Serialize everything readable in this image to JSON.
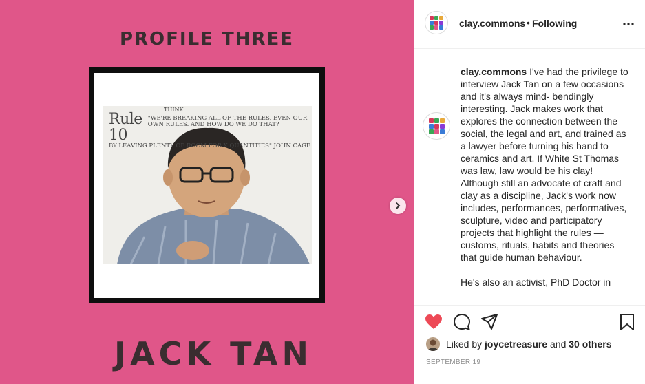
{
  "post_image": {
    "heading": "PROFILE THREE",
    "name": "JACK TAN",
    "background_color": "#e05689",
    "photo_caption": {
      "top": "THINK.",
      "rule": "Rule 10",
      "quote_line1": "\"WE'RE BREAKING ALL OF THE RULES, EVEN OUR OWN RULES. AND HOW DO WE DO THAT?",
      "quote_line2": "BY LEAVING PLENTY OF ROOM FOR X QUANTITIES\" JOHN CAGE"
    },
    "next_icon": "chevron-right-icon"
  },
  "header": {
    "username": "clay.commons",
    "separator": "•",
    "follow_state": "Following",
    "more_icon": "ellipsis-icon"
  },
  "caption": {
    "username": "clay.commons",
    "paragraph1": "I've had the privilege to interview Jack Tan on a few occasions and it's always mind- bendingly interesting. Jack makes work that explores the connection between the social, the legal and art, and trained as a lawyer before turning his hand to ceramics and art. If White St Thomas was law, law would be his clay! Although still an advocate of craft and clay as a discipline, Jack's work now includes, performances, performatives, sculpture, video and participatory projects that highlight the rules — customs, rituals, habits and theories — that guide human behaviour.",
    "paragraph2": "He's also an activist, PhD Doctor in"
  },
  "actions": {
    "like_icon": "heart-icon",
    "comment_icon": "comment-icon",
    "share_icon": "send-icon",
    "save_icon": "bookmark-icon",
    "like_color": "#ed4956"
  },
  "likes": {
    "prefix": "Liked by",
    "user": "joycetreasure",
    "conjunction": "and",
    "others": "30 others"
  },
  "date": "SEPTEMBER 19"
}
